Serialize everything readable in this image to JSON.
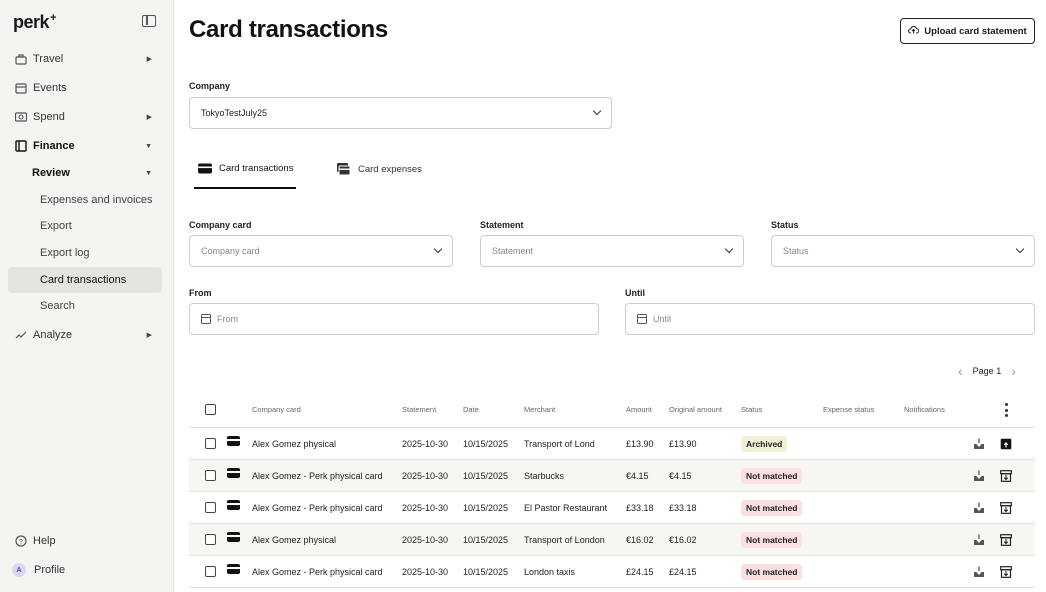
{
  "app": {
    "logo": "perk",
    "logo_plus": "+"
  },
  "sidebar": {
    "items": [
      {
        "label": "Travel",
        "icon": "suitcase-icon"
      },
      {
        "label": "Events",
        "icon": "calendar-icon"
      },
      {
        "label": "Spend",
        "icon": "money-icon"
      },
      {
        "label": "Finance",
        "icon": "ledger-icon"
      }
    ],
    "review_label": "Review",
    "sub_items": [
      "Expenses and invoices",
      "Export",
      "Export log",
      "Card transactions",
      "Search"
    ],
    "analyze_label": "Analyze",
    "help_label": "Help",
    "profile_label": "Profile",
    "profile_initial": "A"
  },
  "header": {
    "title": "Card transactions",
    "upload_label": "Upload card statement"
  },
  "company": {
    "label": "Company",
    "value": "TokyoTestJuly25"
  },
  "tabs": [
    {
      "label": "Card transactions",
      "active": true
    },
    {
      "label": "Card expenses",
      "active": false
    }
  ],
  "filters": {
    "company_card": {
      "label": "Company card",
      "placeholder": "Company card"
    },
    "statement": {
      "label": "Statement",
      "placeholder": "Statement"
    },
    "status": {
      "label": "Status",
      "placeholder": "Status"
    },
    "from": {
      "label": "From",
      "placeholder": "From"
    },
    "until": {
      "label": "Until",
      "placeholder": "Until"
    }
  },
  "pager": {
    "label": "Page 1"
  },
  "table": {
    "columns": [
      "Company card",
      "Statement",
      "Date",
      "Merchant",
      "Amount",
      "Original amount",
      "Status",
      "Expense status",
      "Notifications"
    ],
    "rows": [
      {
        "card": "Alex Gomez physical",
        "statement": "2025-10-30",
        "date": "10/15/2025",
        "merchant": "Transport of Lond",
        "amount": "£13.90",
        "original": "£13.90",
        "status": "Archived"
      },
      {
        "card": "Alex Gomez - Perk physical card",
        "statement": "2025-10-30",
        "date": "10/15/2025",
        "merchant": "Starbucks",
        "amount": "€4.15",
        "original": "€4.15",
        "status": "Not matched"
      },
      {
        "card": "Alex Gomez - Perk physical card",
        "statement": "2025-10-30",
        "date": "10/15/2025",
        "merchant": "El Pastor Restaurant",
        "amount": "£33.18",
        "original": "£33.18",
        "status": "Not matched"
      },
      {
        "card": "Alex Gomez physical",
        "statement": "2025-10-30",
        "date": "10/15/2025",
        "merchant": "Transport of London",
        "amount": "€16.02",
        "original": "€16.02",
        "status": "Not matched"
      },
      {
        "card": "Alex Gomez - Perk physical card",
        "statement": "2025-10-30",
        "date": "10/15/2025",
        "merchant": "London taxis",
        "amount": "£24.15",
        "original": "£24.15",
        "status": "Not matched"
      }
    ]
  }
}
